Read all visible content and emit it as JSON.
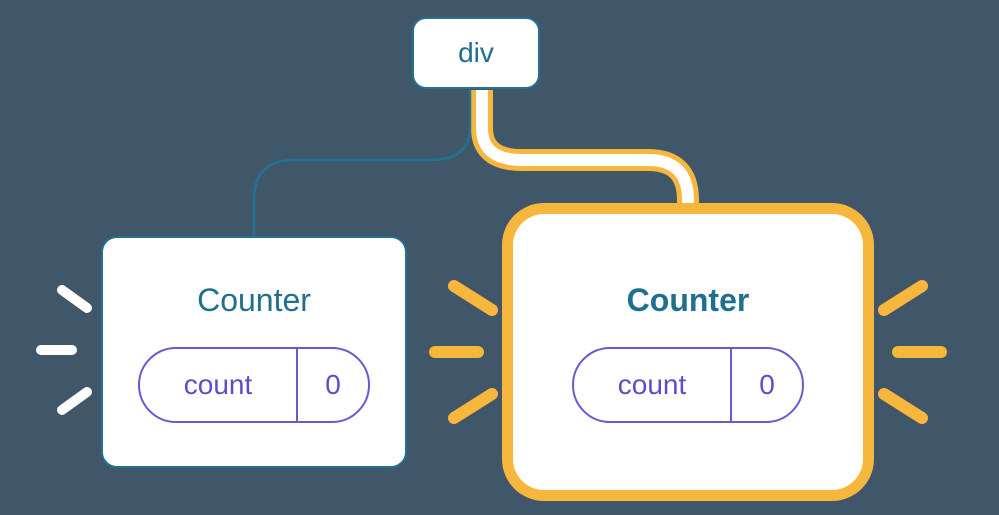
{
  "root": {
    "label": "div"
  },
  "counters": {
    "left": {
      "title": "Counter",
      "state_label": "count",
      "state_value": "0"
    },
    "right": {
      "title": "Counter",
      "state_label": "count",
      "state_value": "0"
    }
  },
  "colors": {
    "background": "#40576a",
    "node_border": "#237293",
    "node_text": "#1f6f8f",
    "highlight": "#f6b73c",
    "state_border": "#6a5acd",
    "state_text": "#5b4fc9",
    "spark_left": "#ffffff",
    "spark_right": "#f6b73c"
  }
}
